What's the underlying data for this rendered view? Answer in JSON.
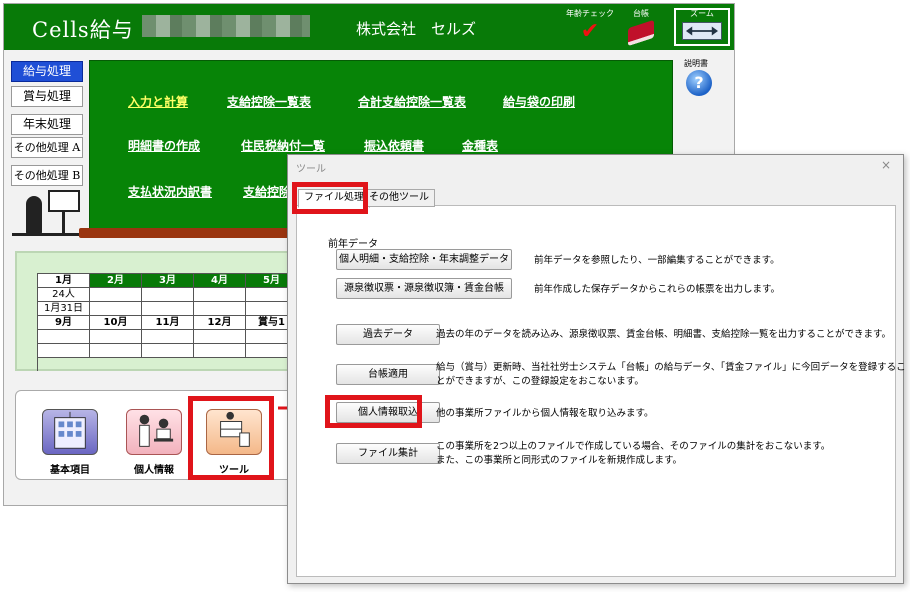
{
  "app": {
    "title": "Cells給与",
    "company": "株式会社　セルズ",
    "age_check_label": "年齢チェック",
    "ledger_label": "台帳",
    "zoom_label": "ズーム",
    "help_label": "説明書",
    "help_glyph": "?"
  },
  "side_menu": [
    {
      "label": "給与処理"
    },
    {
      "label": "賞与処理"
    },
    {
      "label": "年末処理"
    },
    {
      "label": "その他処理 A"
    },
    {
      "label": "その他処理 B"
    }
  ],
  "nav": {
    "calc": "入力と計算",
    "deduction_list": "支給控除一覧表",
    "total_deduction_list": "合計支給控除一覧表",
    "envelope_print": "給与袋の印刷",
    "statement": "明細書の作成",
    "resident_tax": "住民税納付一覧",
    "transfer_request": "振込依頼書",
    "denomination": "金種表",
    "payment_status": "支払状況内訳書",
    "deduction_truncated": "支給控除"
  },
  "calendar": {
    "row1": [
      "1月",
      "2月",
      "3月",
      "4月",
      "5月"
    ],
    "count_cell": "24人",
    "date_cell": "1月31日",
    "row2": [
      "9月",
      "10月",
      "11月",
      "12月",
      "賞与1"
    ]
  },
  "tiles": {
    "basic": "基本項目",
    "person": "個人情報",
    "tool": "ツール"
  },
  "dialog": {
    "title": "ツール",
    "close": "×",
    "tab_file": "ファイル処理",
    "tab_other": "その他ツール",
    "prev_year_label": "前年データ",
    "buttons": {
      "personal_statement": "個人明細・支給控除・年末調整データ",
      "withholding": "源泉徴収票・源泉徴収簿・賃金台帳",
      "past_data": "過去データ",
      "ledger_apply": "台帳適用",
      "import_personal": "個人情報取込",
      "file_aggregate": "ファイル集計"
    },
    "descriptions": {
      "personal_statement": "前年データを参照したり、一部編集することができます。",
      "withholding": "前年作成した保存データからこれらの帳票を出力します。",
      "past_data": "過去の年のデータを読み込み、源泉徴収票、賃金台帳、明細書、支給控除一覧を出力することができます。",
      "ledger_apply_1": "給与（賞与）更新時、当社社労士システム「台帳」の給与データ、「賃金ファイル」に今回データを登録するこ",
      "ledger_apply_2": "とができますが、この登録設定をおこないます。",
      "import_personal": "他の事業所ファイルから個人情報を取り込みます。",
      "file_aggregate_1": "この事業所を2つ以上のファイルで作成している場合、そのファイルの集計をおこないます。",
      "file_aggregate_2": "また、この事業所と同形式のファイルを新規作成します。"
    }
  },
  "colors": {
    "title_green": "#087a08",
    "nav_green": "#078407",
    "highlight_red": "#e0141a",
    "active_blue": "#1f4fd6"
  }
}
